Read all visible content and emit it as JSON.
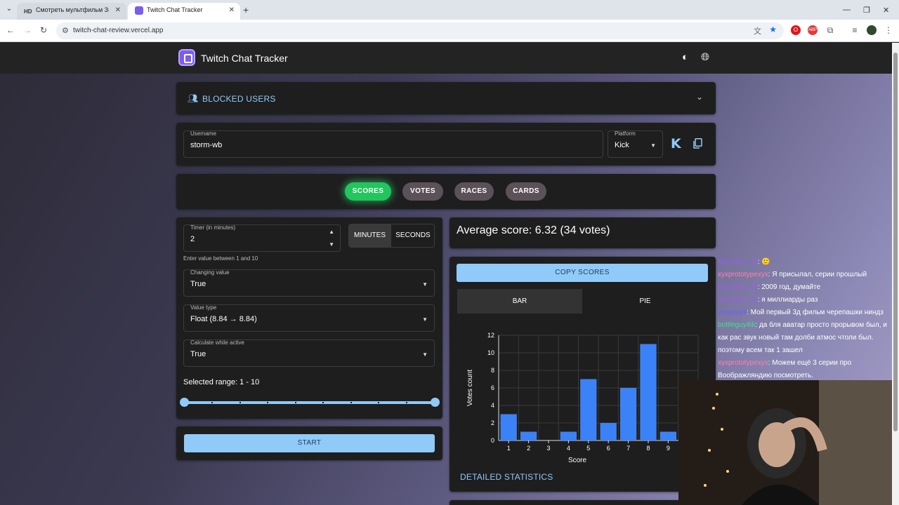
{
  "browser": {
    "tabs": [
      {
        "icon": "HD",
        "title": "Смотреть мультфильм Звероп",
        "active": false
      },
      {
        "icon": "twitch",
        "title": "Twitch Chat Tracker",
        "active": true
      }
    ],
    "url": "twitch-chat-review.vercel.app"
  },
  "app": {
    "title": "Twitch Chat Tracker",
    "blocked_users_label": "BLOCKED USERS",
    "username": {
      "label": "Username",
      "value": "storm-wb"
    },
    "platform": {
      "label": "Platform",
      "value": "Kick"
    },
    "modes": [
      "SCORES",
      "VOTES",
      "RACES",
      "CARDS"
    ],
    "active_mode": "SCORES",
    "timer": {
      "label": "Timer (in minutes)",
      "value": "2",
      "helper": "Enter value between 1 and 10"
    },
    "units": {
      "minutes": "MINUTES",
      "seconds": "SECONDS",
      "selected": "MINUTES"
    },
    "changing_value": {
      "label": "Changing value",
      "value": "True"
    },
    "value_type": {
      "label": "Value type",
      "value": "Float (8.84 → 8.84)"
    },
    "calculate_while_active": {
      "label": "Calculate while active",
      "value": "True"
    },
    "selected_range": "Selected range: 1 - 10",
    "range": {
      "min": 1,
      "max": 10
    },
    "start_label": "START",
    "average": "Average score: 6.32 (34 votes)",
    "copy_scores_label": "COPY SCORES",
    "chart_tabs": [
      "BAR",
      "PIE"
    ],
    "active_chart_tab": "BAR",
    "detailed_label": "DETAILED STATISTICS"
  },
  "chart_data": {
    "type": "bar",
    "categories": [
      "1",
      "2",
      "3",
      "4",
      "5",
      "6",
      "7",
      "8",
      "9"
    ],
    "values": [
      3,
      1,
      0,
      1,
      7,
      2,
      6,
      11,
      1
    ],
    "xlabel": "Score",
    "ylabel": "Votes count",
    "ylim": [
      0,
      12
    ],
    "yticks": [
      "0",
      "2",
      "4",
      "6",
      "8",
      "10",
      "12"
    ],
    "grid": true,
    "bar_color": "#3b82f6"
  },
  "chat": [
    {
      "user": "Marcellus_M",
      "color": "#9b5de5",
      "text": "🙂"
    },
    {
      "user": "xyxprototypexyx",
      "color": "#ff7fb0",
      "text": "Я присылал, серии прошлый"
    },
    {
      "user": "Marcellus_M",
      "color": "#9b5de5",
      "text": "2009 год, думайте"
    },
    {
      "user": "Marcellus_M",
      "color": "#9b5de5",
      "text": "я миллиарды раз"
    },
    {
      "user": "zxcpavyk",
      "color": "#6a5cff",
      "text": "Мой первый 3д фильм черепашки ниндз"
    },
    {
      "user": "bottleguy4ik",
      "color": "#3ee08f",
      "text": "да бля аватар просто прорывом был, и как рас звук новый там долби атмос чтоли был. поэтому всем так 1 зашел"
    },
    {
      "user": "xyxprototypexyx",
      "color": "#ff7fb0",
      "text": "Можем ещё 3 серии про Воображляндию посмотреть."
    }
  ],
  "colors": {
    "accent": "#90caf9",
    "active_mode": "#22c55e",
    "card": "#1e1e1e"
  }
}
